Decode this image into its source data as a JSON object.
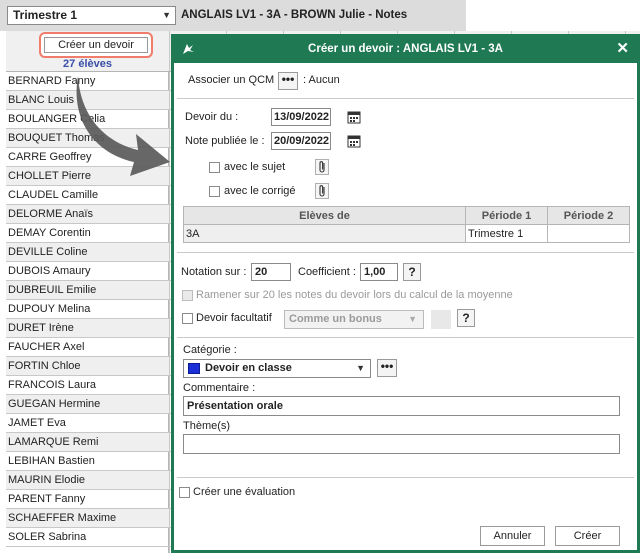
{
  "topbar": {
    "period_value": "Trimestre 1",
    "title": "ANGLAIS LV1 - 3A - BROWN Julie - Notes"
  },
  "left_panel": {
    "create_button_label": "Créer un devoir",
    "students_count": "27 élèves",
    "students": [
      "BERNARD Fanny",
      "BLANC Louis",
      "BOULANGER Celia",
      "BOUQUET Thomas",
      "CARRE Geoffrey",
      "CHOLLET Pierre",
      "CLAUDEL Camille",
      "DELORME Anaïs",
      "DEMAY Corentin",
      "DEVILLE Coline",
      "DUBOIS Amaury",
      "DUBREUIL Emilie",
      "DUPOUY Melina",
      "DURET Irène",
      "FAUCHER Axel",
      "FORTIN Chloe",
      "FRANCOIS Laura",
      "GUEGAN Hermine",
      "JAMET Eva",
      "LAMARQUE Remi",
      "LEBIHAN Bastien",
      "MAURIN Elodie",
      "PARENT Fanny",
      "SCHAEFFER Maxime",
      "SOLER Sabrina"
    ]
  },
  "dialog": {
    "title": "Créer un devoir : ANGLAIS LV1 - 3A",
    "qcm_label": "Associer un QCM",
    "qcm_dots": "•••",
    "qcm_value": ": Aucun",
    "devoir_du_label": "Devoir du :",
    "devoir_du_value": "13/09/2022",
    "note_publiee_label": "Note publiée le :",
    "note_publiee_value": "20/09/2022",
    "avec_sujet_label": "avec le sujet",
    "avec_corrige_label": "avec le corrigé",
    "table": {
      "headers": [
        "Elèves de",
        "Période 1",
        "Période 2"
      ],
      "rows": [
        [
          "3A",
          "Trimestre 1",
          ""
        ]
      ]
    },
    "notation_label": "Notation sur :",
    "notation_value": "20",
    "coefficient_label": "Coefficient :",
    "coefficient_value": "1,00",
    "help_label": "?",
    "ramener_label": "Ramener sur 20 les notes du devoir lors du calcul de la moyenne",
    "facultatif_label": "Devoir facultatif",
    "bonus_value": "Comme un bonus",
    "categorie_label": "Catégorie :",
    "categorie_value": "Devoir en classe",
    "categorie_color": "#1a2fd6",
    "categorie_dots": "•••",
    "commentaire_label": "Commentaire :",
    "commentaire_value": "Présentation orale",
    "themes_label": "Thème(s)",
    "themes_value": "",
    "evaluation_label": "Créer une évaluation",
    "cancel_label": "Annuler",
    "create_label": "Créer",
    "close_label": "✕",
    "accent_color": "#1f7a54"
  }
}
